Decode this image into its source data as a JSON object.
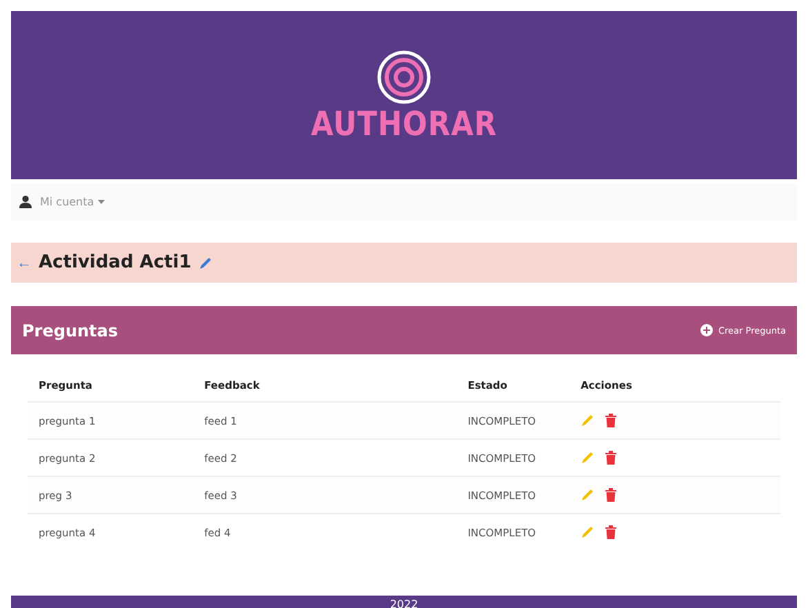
{
  "header": {
    "logo_text": "AUTHORAR"
  },
  "nav": {
    "account_menu": "Mi cuenta"
  },
  "page_title": {
    "back": "←",
    "title": "Actividad Acti1"
  },
  "card": {
    "title": "Preguntas",
    "create_button": "Crear Pregunta",
    "table": {
      "columns": [
        "Pregunta",
        "Feedback",
        "Estado",
        "Acciones"
      ],
      "rows": [
        {
          "pregunta": "pregunta 1",
          "feedback": "feed 1",
          "estado": "INCOMPLETO"
        },
        {
          "pregunta": "pregunta 2",
          "feedback": "feed 2",
          "estado": "INCOMPLETO"
        },
        {
          "pregunta": "preg 3",
          "feedback": "feed 3",
          "estado": "INCOMPLETO"
        },
        {
          "pregunta": "pregunta 4",
          "feedback": "fed 4",
          "estado": "INCOMPLETO"
        }
      ]
    }
  },
  "footer": {
    "text": "2022"
  }
}
